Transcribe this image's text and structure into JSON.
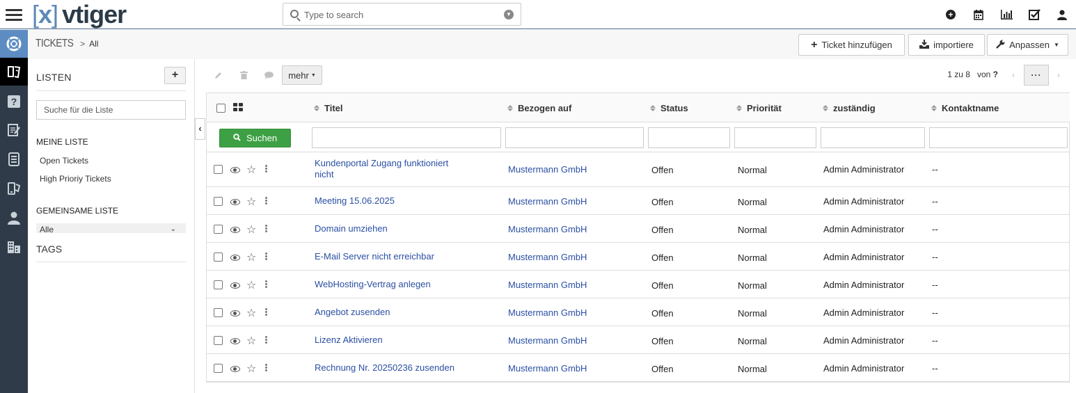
{
  "app": {
    "logo_bracket_open": "[",
    "logo_x": "x",
    "logo_bracket_close": "]",
    "logo_name": "vtiger"
  },
  "search": {
    "placeholder": "Type to search"
  },
  "breadcrumb": {
    "module": "TICKETS",
    "separator": ">",
    "current": "All"
  },
  "actions": {
    "add_ticket": "Ticket hinzufügen",
    "import": "importiere",
    "customize": "Anpassen"
  },
  "sidebar": {
    "title": "LISTEN",
    "add_label": "+",
    "search_placeholder": "Suche für die Liste",
    "my_lists_header": "MEINE LISTE",
    "my_lists": [
      "Open Tickets",
      "High Prioriy Tickets"
    ],
    "shared_header": "GEMEINSAME LISTE",
    "shared_selected": "Alle",
    "tags_header": "TAGS"
  },
  "toolbar": {
    "more_label": "mehr"
  },
  "pagination": {
    "range": "1 zu 8",
    "of_label": "von",
    "total": "?"
  },
  "table": {
    "search_button": "Suchen",
    "columns": [
      "Titel",
      "Bezogen auf",
      "Status",
      "Priorität",
      "zuständig",
      "Kontaktname"
    ],
    "rows": [
      {
        "title": "Kundenportal Zugang funktioniert nicht",
        "related": "Mustermann GmbH",
        "status": "Offen",
        "priority": "Normal",
        "assigned": "Admin Administrator",
        "contact": "--"
      },
      {
        "title": "Meeting 15.06.2025",
        "related": "Mustermann GmbH",
        "status": "Offen",
        "priority": "Normal",
        "assigned": "Admin Administrator",
        "contact": "--"
      },
      {
        "title": "Domain umziehen",
        "related": "Mustermann GmbH",
        "status": "Offen",
        "priority": "Normal",
        "assigned": "Admin Administrator",
        "contact": "--"
      },
      {
        "title": "E-Mail Server nicht erreichbar",
        "related": "Mustermann GmbH",
        "status": "Offen",
        "priority": "Normal",
        "assigned": "Admin Administrator",
        "contact": "--"
      },
      {
        "title": "WebHosting-Vertrag anlegen",
        "related": "Mustermann GmbH",
        "status": "Offen",
        "priority": "Normal",
        "assigned": "Admin Administrator",
        "contact": "--"
      },
      {
        "title": "Angebot zusenden",
        "related": "Mustermann GmbH",
        "status": "Offen",
        "priority": "Normal",
        "assigned": "Admin Administrator",
        "contact": "--"
      },
      {
        "title": "Lizenz Aktivieren",
        "related": "Mustermann GmbH",
        "status": "Offen",
        "priority": "Normal",
        "assigned": "Admin Administrator",
        "contact": "--"
      },
      {
        "title": "Rechnung Nr. 20250236 zusenden",
        "related": "Mustermann GmbH",
        "status": "Offen",
        "priority": "Normal",
        "assigned": "Admin Administrator",
        "contact": "--"
      }
    ]
  },
  "colors": {
    "link": "#2a4fa3",
    "rail": "#2f3b48",
    "rail_active": "#5c8cc2",
    "search_button": "#3ea044"
  },
  "icons": {
    "top": [
      "add-icon",
      "calendar-icon",
      "reports-icon",
      "tasks-icon",
      "user-icon"
    ],
    "rail": [
      "helpdesk-icon",
      "tickets-icon",
      "faq-icon",
      "quotes-icon",
      "invoices-icon",
      "service-contracts-icon",
      "contacts-icon",
      "organizations-icon"
    ]
  }
}
